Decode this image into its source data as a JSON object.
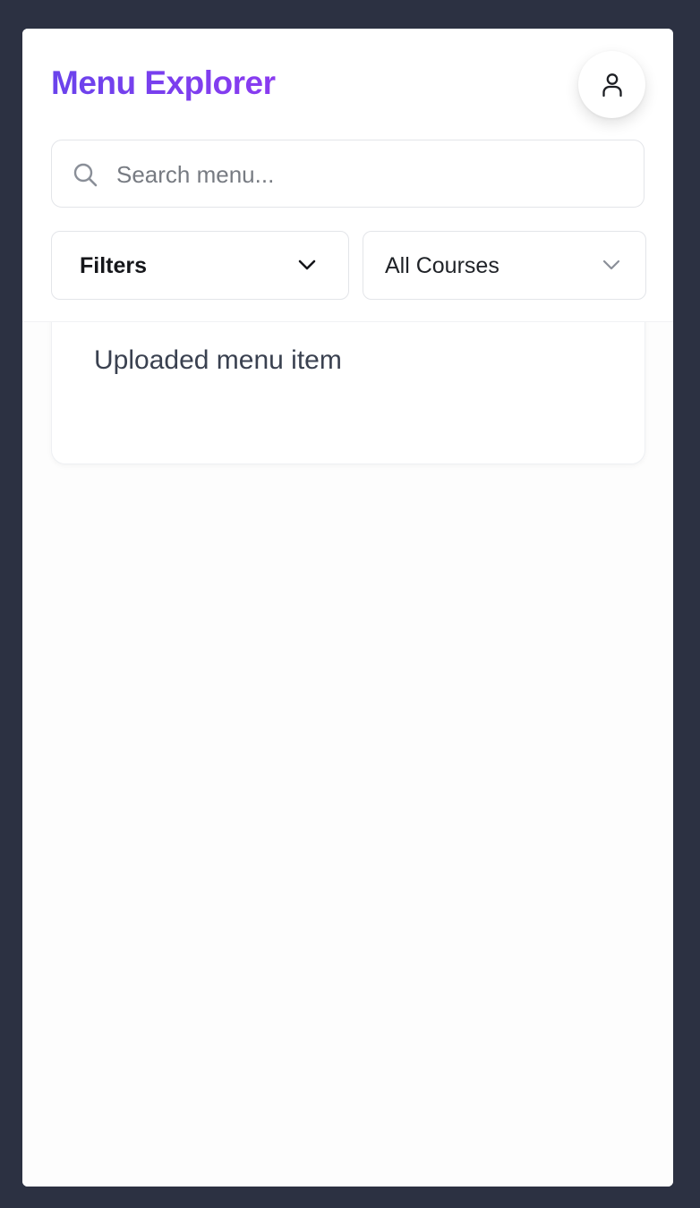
{
  "header": {
    "title": "Menu Explorer",
    "title_gradient": [
      "#6a43ec",
      "#8a3bf0"
    ],
    "profile_icon": "user-icon"
  },
  "search": {
    "placeholder": "Search menu...",
    "value": "",
    "icon": "search-icon"
  },
  "filters": {
    "filters_label": "Filters",
    "course_selected": "All Courses",
    "dropdown_icon": "chevron-down-icon"
  },
  "menu_items": [
    {
      "name": "Uploaded menu item"
    }
  ],
  "colors": {
    "outer_background": "#2c3142",
    "panel_background": "#ffffff",
    "accent": "#6a43ec"
  }
}
